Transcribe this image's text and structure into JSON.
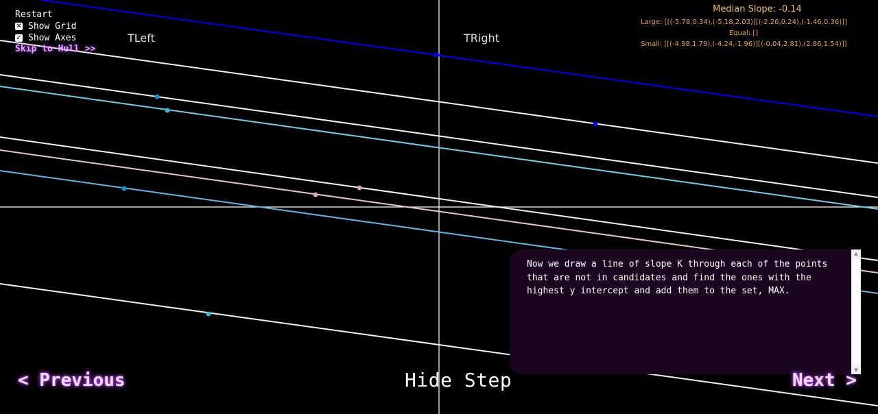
{
  "menu": {
    "restart": "Restart",
    "show_grid": "Show Grid",
    "show_grid_checked": false,
    "show_axes": "Show Axes",
    "show_axes_checked": true,
    "skip": "Skip to Hull >>"
  },
  "quadrants": {
    "left": "TLeft",
    "right": "TRight"
  },
  "info": {
    "median": "Median Slope: -0.14",
    "large": "Large: [[(-5.78,0.34),(-5.18,2.03)][(-2.26,0.24),(-1.46,0.36)]]",
    "equal": "Equal: []",
    "small": "Small: [[(-4.98,1.79),(-4.24,-1.96)][(-0.04,2.81),(2.86,1.54)]]"
  },
  "panel": {
    "text": "Now we draw a line of slope K through each of the points that are not in candidates and find the ones with the highest y intercept and add them to the set, MAX."
  },
  "nav": {
    "previous": "< Previous",
    "hide": "Hide Step",
    "next": "Next >"
  },
  "colors": {
    "background": "#000000",
    "max_line": "#0000cc",
    "white_line": "#f2f2f2",
    "cyan_line": "#6ecfee",
    "pink_line": "#e8c4cc",
    "accent_glow": "#c050ff",
    "panel": "#1a0620",
    "info_text": "#e8a640"
  }
}
